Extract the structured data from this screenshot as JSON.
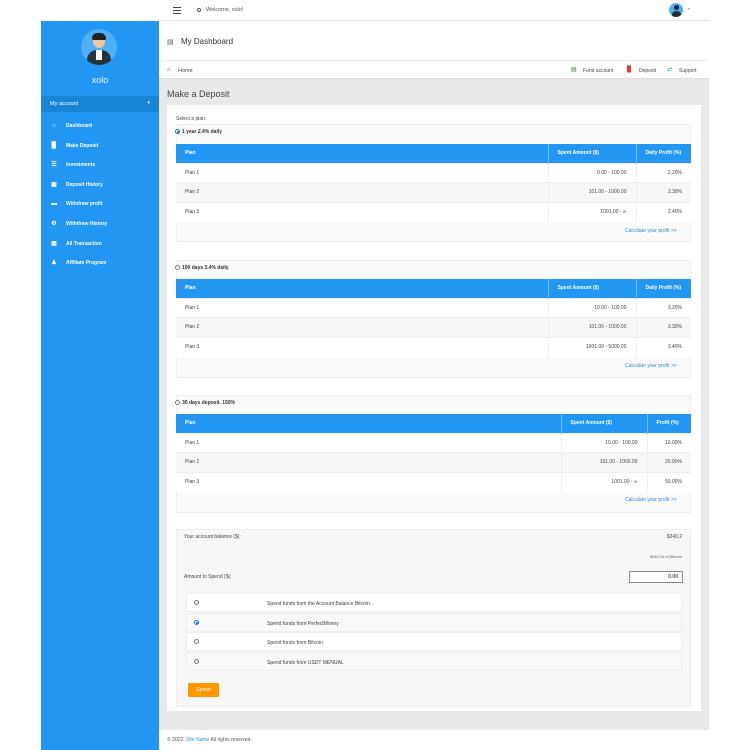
{
  "topbar": {
    "welcome": "Welcome, xolo!"
  },
  "sidebar": {
    "username": "xolo",
    "section": "My account",
    "items": [
      {
        "label": "Dashboard",
        "icon": "home-icon"
      },
      {
        "label": "Make Deposit",
        "icon": "bar-chart-icon"
      },
      {
        "label": "Investments",
        "icon": "list-icon"
      },
      {
        "label": "Deposit History",
        "icon": "folder-icon"
      },
      {
        "label": "Withdraw profit",
        "icon": "money-icon"
      },
      {
        "label": "Withdraw History",
        "icon": "gear-icon"
      },
      {
        "label": "All Transaction",
        "icon": "bank-icon"
      },
      {
        "label": "Affiliate Program",
        "icon": "users-icon"
      }
    ]
  },
  "header": {
    "title": "My Dashboard"
  },
  "breadcrumb": {
    "home": "Home",
    "fund": "Fund account",
    "deposit": "Deposit",
    "support": "Support"
  },
  "page": {
    "title": "Make a Deposit",
    "select_label": "Select a plan:"
  },
  "plans": [
    {
      "name": "1 year 2.4% daily",
      "selected": true,
      "headers": [
        "Plan",
        "Spent Amount ($)",
        "Daily Profit (%)"
      ],
      "rows": [
        [
          "Plan 1",
          "0.00 - 100.00",
          "2.20%"
        ],
        [
          "Plan 2",
          "101.00 - 1000.00",
          "2.30%"
        ],
        [
          "Plan 3",
          "1001.00 - ∞",
          "2.40%"
        ]
      ],
      "calc": "Calculate your profit >>"
    },
    {
      "name": "100 days 3.4% daily",
      "selected": false,
      "headers": [
        "Plan",
        "Spent Amount ($)",
        "Daily Profit (%)"
      ],
      "rows": [
        [
          "Plan 1",
          "10.00 - 100.00",
          "3.20%"
        ],
        [
          "Plan 2",
          "101.00 - 1000.00",
          "3.30%"
        ],
        [
          "Plan 3",
          "1001.00 - 5000.00",
          "3.40%"
        ]
      ],
      "calc": "Calculate your profit >>"
    },
    {
      "name": "30 days deposit. 150%",
      "selected": false,
      "headers": [
        "Plan",
        "Spent Amount ($)",
        "Profit (%)"
      ],
      "rows": [
        [
          "Plan 1",
          "10.00 - 100.00",
          "10.00%"
        ],
        [
          "Plan 2",
          "101.00 - 1000.00",
          "20.00%"
        ],
        [
          "Plan 3",
          "1001.00 - ∞",
          "50.00%"
        ]
      ],
      "calc": "Calculate your profit >>"
    }
  ],
  "balance": {
    "label": "Your account balance ($):",
    "value": "$340.2",
    "btc": "$340.2# of Bitcoin",
    "amount_label": "Amount to Spend ($):",
    "amount_value": "0.00"
  },
  "payment_options": [
    {
      "label": "Spend funds from the Account Balance Bitcoin",
      "selected": false
    },
    {
      "label": "Spend funds from PerfectMoney",
      "selected": true
    },
    {
      "label": "Spend funds from Bitcoin",
      "selected": false
    },
    {
      "label": "Spend funds from USDT MENUAL",
      "selected": false
    }
  ],
  "spend_button": "Spend",
  "footer": {
    "copyright": "© 2023.",
    "site_name": "Site Name",
    "rights": "All rights reserved."
  },
  "colors": {
    "primary": "#2196f3",
    "accent": "#ff9800",
    "link": "#2a8be0"
  }
}
